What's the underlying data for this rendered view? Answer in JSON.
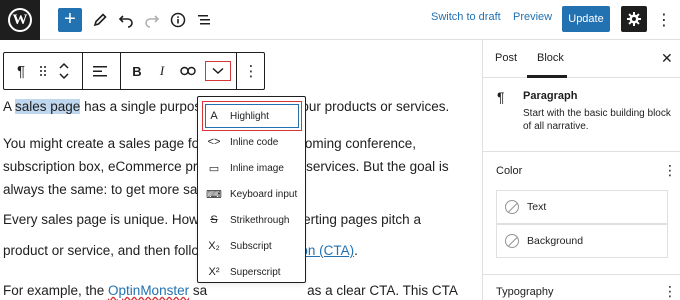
{
  "topbar": {
    "logo_letter": "W",
    "add_glyph": "+",
    "icons": [
      "pencil-icon",
      "undo-icon",
      "redo-icon",
      "info-icon",
      "list-view-icon"
    ],
    "switch_to_draft": "Switch to draft",
    "preview": "Preview",
    "update": "Update"
  },
  "block_toolbar": {
    "paragraph_glyph": "¶",
    "bold": "B",
    "italic": "I"
  },
  "content": {
    "p1": {
      "before": "A ",
      "highlighted": "sales page",
      "after": " has a single purpos",
      "tail": "y your products or services."
    },
    "p2_line1_a": "You might create a sales page fo",
    "p2_line1_b": "upcoming conference,",
    "p2_line2_a": "subscription box, eCommerce pro",
    "p2_line2_b": "cy services. But the goal is",
    "p3_line_a": "always the same: to get more sal",
    "p3_line_b": "s.",
    "p4_line1_a": "Every sales page is unique. Howe",
    "p4_line1_b": "verting pages pitch a",
    "p4_line2_a": "product or service, and then follo",
    "p4_line2_link": "ction (CTA)",
    "p4_line2_end": ".",
    "p5_a": "For example, the ",
    "p5_link": "OptinMonster",
    "p5_b": " sa",
    "p5_c": "as a clear CTA. This CTA"
  },
  "format_menu": {
    "items": [
      {
        "label": "Highlight",
        "icon": "A"
      },
      {
        "label": "Inline code",
        "icon": "<>"
      },
      {
        "label": "Inline image",
        "icon": "▭"
      },
      {
        "label": "Keyboard input",
        "icon": "⌨"
      },
      {
        "label": "Strikethrough",
        "icon": "S"
      },
      {
        "label": "Subscript",
        "icon": "X₂"
      },
      {
        "label": "Superscript",
        "icon": "X²"
      }
    ]
  },
  "sidebar": {
    "tabs": [
      "Post",
      "Block"
    ],
    "active_tab": "Block",
    "block_title": "Paragraph",
    "block_desc_1": "Start with the basic building block",
    "block_desc_2": "of all narrative.",
    "color_heading": "Color",
    "color_options": [
      "Text",
      "Background"
    ],
    "typography_heading": "Typography"
  },
  "colors": {
    "accent": "#2271b1",
    "annotation_red": "#d63638",
    "selection": "#bfd6ef"
  }
}
